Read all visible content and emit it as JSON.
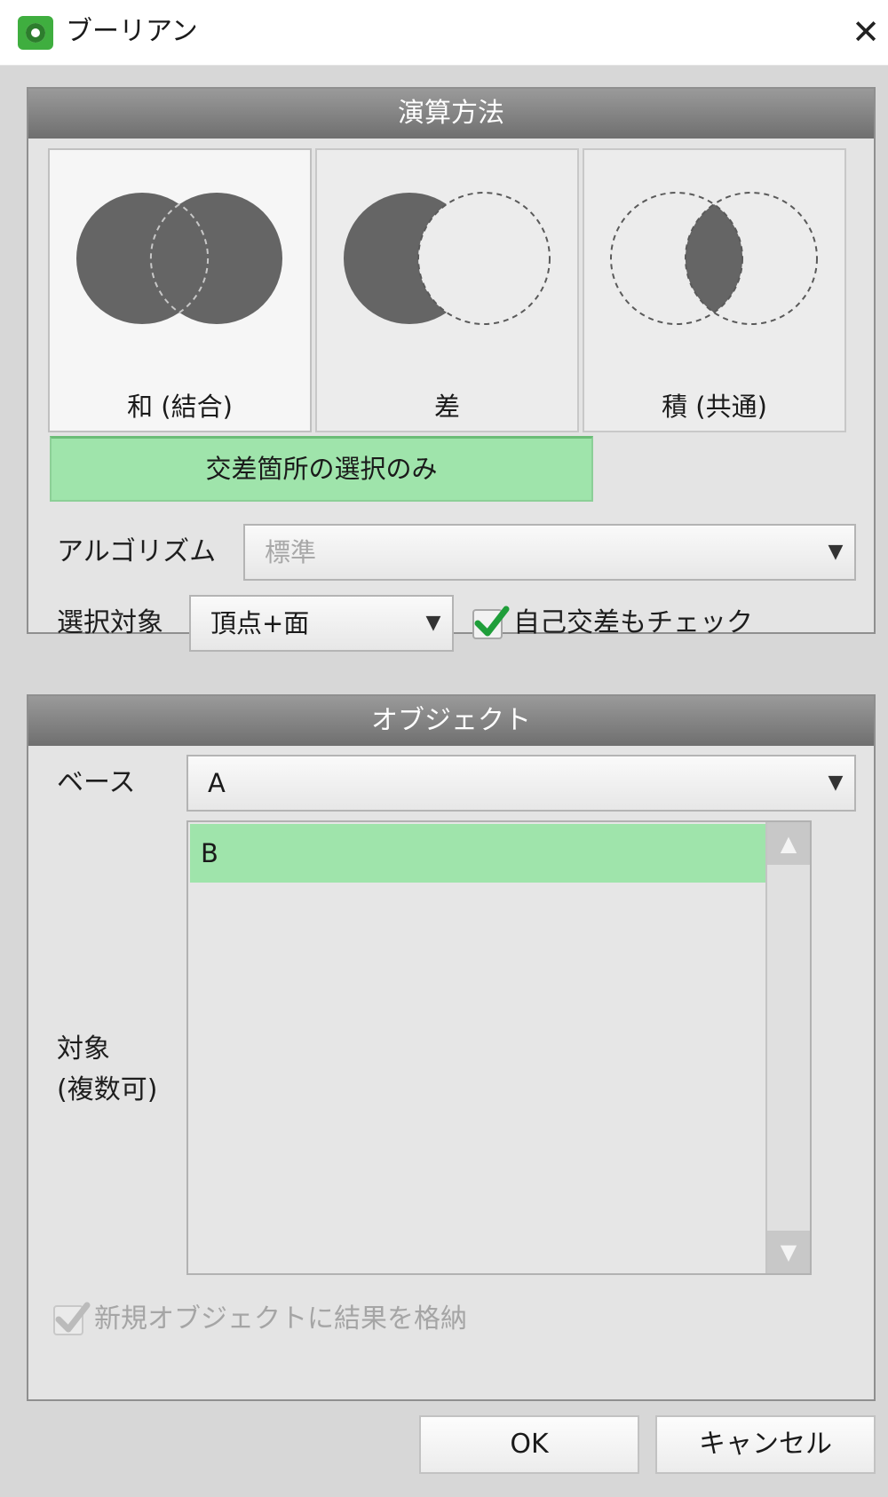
{
  "window": {
    "title": "ブーリアン",
    "close_glyph": "✕"
  },
  "operation": {
    "header": "演算方法",
    "options": [
      {
        "label": "和 (結合)",
        "selected": true
      },
      {
        "label": "差",
        "selected": false
      },
      {
        "label": "積 (共通)",
        "selected": false
      }
    ],
    "intersect_only_label": "交差箇所の選択のみ",
    "algorithm_label": "アルゴリズム",
    "algorithm_value": "標準",
    "selection_label": "選択対象",
    "selection_value": "頂点+面",
    "self_intersect_label": "自己交差もチェック",
    "self_intersect_checked": true
  },
  "objects": {
    "header": "オブジェクト",
    "base_label": "ベース",
    "base_value": "A",
    "targets_label_line1": "対象",
    "targets_label_line2": "(複数可)",
    "targets": [
      "B"
    ],
    "store_new_label": "新規オブジェクトに結果を格納",
    "store_new_checked": true
  },
  "buttons": {
    "ok": "OK",
    "cancel": "キャンセル"
  },
  "colors": {
    "highlight_green": "#9fe4ab",
    "check_green": "#1f9e3a",
    "header_gray": "#7f7f7f",
    "shape_fill": "#656565"
  },
  "icons": {
    "app": "app-icon",
    "close": "close-icon",
    "dropdown": "triangle-down-icon",
    "check": "checkmark-icon"
  }
}
